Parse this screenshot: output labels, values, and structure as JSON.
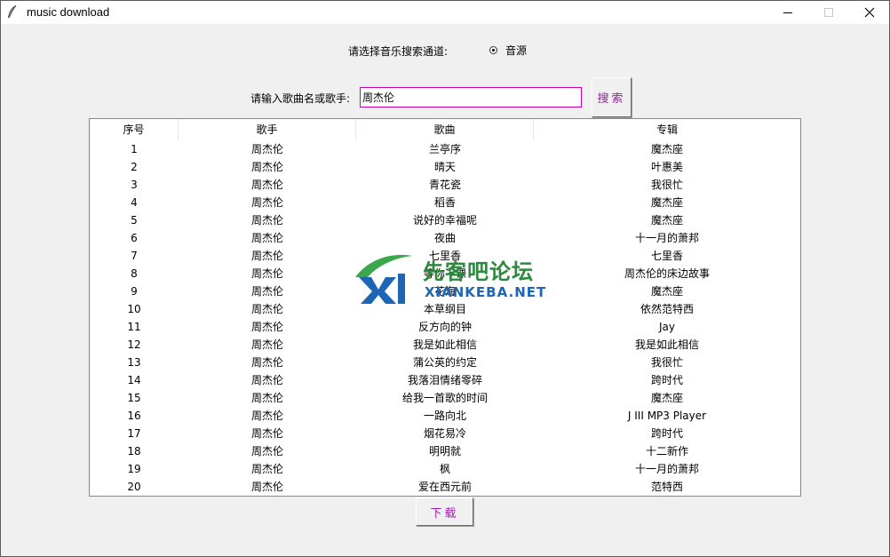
{
  "window": {
    "title": "music download",
    "app_icon": "feather-icon",
    "controls": [
      "minimize-icon",
      "maximize-icon",
      "close-icon"
    ]
  },
  "channel": {
    "label": "请选择音乐搜索通道:",
    "option_label": "音源",
    "selected": true
  },
  "search": {
    "label": "请输入歌曲名或歌手:",
    "value": "周杰伦",
    "button_label": "搜索"
  },
  "table": {
    "columns": [
      "序号",
      "歌手",
      "歌曲",
      "专辑"
    ],
    "rows": [
      [
        "1",
        "周杰伦",
        "兰亭序",
        "魔杰座"
      ],
      [
        "2",
        "周杰伦",
        "晴天",
        "叶惠美"
      ],
      [
        "3",
        "周杰伦",
        "青花瓷",
        "我很忙"
      ],
      [
        "4",
        "周杰伦",
        "稻香",
        "魔杰座"
      ],
      [
        "5",
        "周杰伦",
        "说好的幸福呢",
        "魔杰座"
      ],
      [
        "6",
        "周杰伦",
        "夜曲",
        "十一月的萧邦"
      ],
      [
        "7",
        "周杰伦",
        "七里香",
        "七里香"
      ],
      [
        "8",
        "周杰伦",
        "等你下课",
        "周杰伦的床边故事"
      ],
      [
        "9",
        "周杰伦",
        "花海",
        "魔杰座"
      ],
      [
        "10",
        "周杰伦",
        "本草纲目",
        "依然范特西"
      ],
      [
        "11",
        "周杰伦",
        "反方向的钟",
        "Jay"
      ],
      [
        "12",
        "周杰伦",
        "我是如此相信",
        "我是如此相信"
      ],
      [
        "13",
        "周杰伦",
        "蒲公英的约定",
        "我很忙"
      ],
      [
        "14",
        "周杰伦",
        "我落泪情绪零碎",
        "跨时代"
      ],
      [
        "15",
        "周杰伦",
        "给我一首歌的时间",
        "魔杰座"
      ],
      [
        "16",
        "周杰伦",
        "一路向北",
        "J III MP3 Player"
      ],
      [
        "17",
        "周杰伦",
        "烟花易冷",
        "跨时代"
      ],
      [
        "18",
        "周杰伦",
        "明明就",
        "十二新作"
      ],
      [
        "19",
        "周杰伦",
        "枫",
        "十一月的萧邦"
      ],
      [
        "20",
        "周杰伦",
        "爱在西元前",
        "范特西"
      ]
    ]
  },
  "download": {
    "button_label": "下载"
  },
  "watermark": {
    "cn": "先客吧论坛",
    "en": "XIANKEBA.NET"
  },
  "colors": {
    "accent_text": "#9b1fa8",
    "input_border": "#c000c0",
    "watermark_green": "#2b8a3e",
    "watermark_blue": "#1e66b5"
  }
}
